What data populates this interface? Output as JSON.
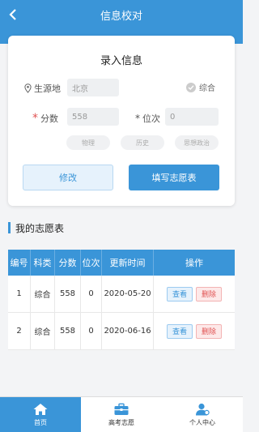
{
  "header": {
    "title": "信息校对"
  },
  "form": {
    "title": "录入信息",
    "origin_label": "生源地",
    "origin_value": "北京",
    "type_label": "综合",
    "score_label": "分数",
    "score_required_mark": "*",
    "score_value": "558",
    "rank_label": "位次",
    "rank_required_mark": "*",
    "rank_value": "0",
    "subjects": [
      "物理",
      "历史",
      "思想政治"
    ],
    "edit_button": "修改",
    "fill_button": "填写志愿表"
  },
  "section": {
    "title": "我的志愿表"
  },
  "table": {
    "columns": [
      "编号",
      "科类",
      "分数",
      "位次",
      "更新时间",
      "操作"
    ],
    "rows": [
      {
        "id": "1",
        "type": "综合",
        "score": "558",
        "rank": "0",
        "updated": "2020-05-20",
        "view": "查看",
        "delete": "删除"
      },
      {
        "id": "2",
        "type": "综合",
        "score": "558",
        "rank": "0",
        "updated": "2020-06-16",
        "view": "查看",
        "delete": "删除"
      }
    ]
  },
  "tabbar": {
    "items": [
      {
        "label": "首页",
        "icon": "home-icon"
      },
      {
        "label": "高考志愿",
        "icon": "briefcase-icon"
      },
      {
        "label": "个人中心",
        "icon": "user-icon"
      }
    ]
  },
  "colors": {
    "primary": "#3a95d8",
    "danger": "#e05353"
  }
}
